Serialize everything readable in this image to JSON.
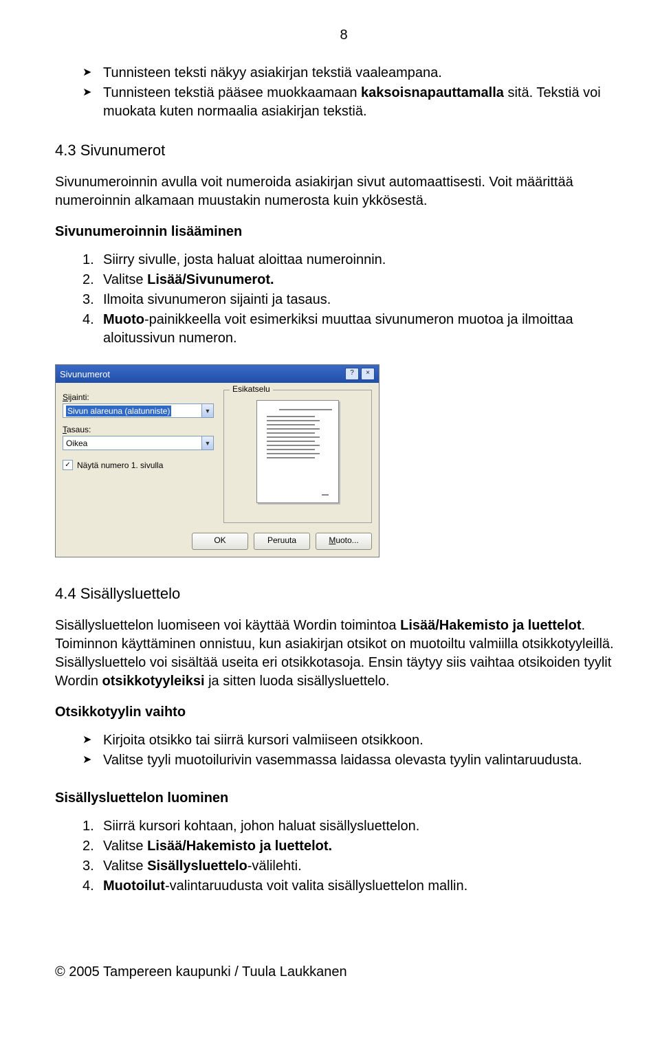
{
  "page_number": "8",
  "intro_bullets": [
    {
      "pre": "Tunnisteen teksti näkyy asiakirjan tekstiä vaaleampana."
    },
    {
      "pre": "Tunnisteen tekstiä pääsee muokkaamaan ",
      "bold": "kaksoisnapauttamalla",
      "post": " sitä. Tekstiä voi muokata kuten normaalia asiakirjan tekstiä."
    }
  ],
  "sec43": {
    "title": "4.3 Sivunumerot",
    "para": "Sivunumeroinnin avulla voit numeroida asiakirjan sivut automaattisesti. Voit määrittää numeroinnin alkamaan muustakin numerosta kuin ykkösestä.",
    "sub": "Sivunumeroinnin lisääminen",
    "steps": [
      {
        "pre": "Siirry sivulle, josta haluat aloittaa numeroinnin."
      },
      {
        "pre": "Valitse ",
        "bold": "Lisää/Sivunumerot.",
        "post": ""
      },
      {
        "pre": "Ilmoita sivunumeron sijainti ja tasaus."
      },
      {
        "bold_first": "Muoto",
        "post": "-painikkeella voit esimerkiksi muuttaa sivunumeron muotoa ja ilmoittaa aloitussivun numeron."
      }
    ]
  },
  "dialog": {
    "title": "Sivunumerot",
    "sijainti_label_u": "S",
    "sijainti_label_rest": "ijainti:",
    "sijainti_value": "Sivun alareuna (alatunniste)",
    "tasaus_label_u": "T",
    "tasaus_label_rest": "asaus:",
    "tasaus_value": "Oikea",
    "chk_u": "N",
    "chk_rest": "äytä numero 1. sivulla",
    "preview_legend": "Esikatselu",
    "btn_ok": "OK",
    "btn_cancel": "Peruuta",
    "btn_format_u": "M",
    "btn_format_rest": "uoto..."
  },
  "sec44": {
    "title": "4.4 Sisällysluettelo",
    "para1_pre": "Sisällysluettelon luomiseen voi käyttää Wordin toimintoa ",
    "para1_bold": "Lisää/Hakemisto ja luettelot",
    "para1_mid": ". Toiminnon käyttäminen onnistuu, kun asiakirjan otsikot on muotoiltu valmiilla otsikkotyyleillä. Sisällysluettelo voi sisältää useita eri otsikkotasoja. Ensin täytyy siis vaihtaa otsikoiden tyylit Wordin ",
    "para1_bold2": "otsikkotyyleiksi",
    "para1_post": " ja sitten luoda sisällysluettelo.",
    "sub1": "Otsikkotyylin vaihto",
    "bullets1": [
      "Kirjoita otsikko tai siirrä kursori valmiiseen otsikkoon.",
      "Valitse tyyli muotoilurivin vasemmassa laidassa olevasta tyylin valintaruudusta."
    ],
    "sub2": "Sisällysluettelon luominen",
    "steps2": [
      {
        "pre": "Siirrä kursori kohtaan, johon haluat sisällysluettelon."
      },
      {
        "pre": "Valitse ",
        "bold": "Lisää/Hakemisto ja luettelot.",
        "post": ""
      },
      {
        "pre": "Valitse ",
        "bold": "Sisällysluettelo",
        "post": "-välilehti."
      },
      {
        "bold_first": "Muotoilut",
        "post": "-valintaruudusta voit valita sisällysluettelon mallin."
      }
    ]
  },
  "copyright": "© 2005 Tampereen kaupunki / Tuula Laukkanen"
}
